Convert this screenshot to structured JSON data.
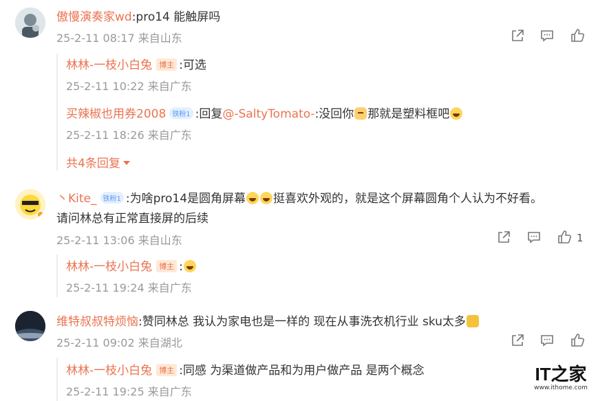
{
  "comments": [
    {
      "user": "傲慢演奏家wd",
      "text": ":pro14 能触屏吗",
      "time": "25-2-11 08:17 来自山东",
      "replies": [
        {
          "user": "林林-一枝小白兔",
          "badge": "博主",
          "text": ":可选",
          "time": "25-2-11 10:22 来自广东"
        },
        {
          "user": "买辣椒也用券2008",
          "badge": "铁粉1",
          "prefix": ":回复",
          "mention": "@-SaltyTomato-",
          "text_a": ":没回你",
          "text_b": "那就是塑料框吧",
          "time": "25-2-11 18:26 来自广东"
        }
      ],
      "more_label": "共4条回复"
    },
    {
      "user": "丶Kite_",
      "badge": "铁粉1",
      "text_a": ":为啥pro14是圆角屏幕",
      "text_b": "挺喜欢外观的，就是这个屏幕圆角个人认为不好看。",
      "text_c": "请问林总有正常直接屏的后续",
      "time": "25-2-11 13:06 来自山东",
      "like_count": "1",
      "replies": [
        {
          "user": "林林-一枝小白兔",
          "badge": "博主",
          "text": ":",
          "time": "25-2-11 19:24 来自广东"
        }
      ]
    },
    {
      "user": "维特叔叔特烦恼",
      "text": ":赞同林总 我认为家电也是一样的 现在从事洗衣机行业 sku太多",
      "time": "25-2-11 09:02 来自湖北",
      "replies": [
        {
          "user": "林林-一枝小白兔",
          "badge": "博主",
          "text": ":同感 为渠道做产品和为用户做产品 是两个概念",
          "time": "25-2-11 19:25 来自广东"
        }
      ]
    }
  ],
  "logo": {
    "text": "IT之家",
    "url": "www.ithome.com"
  }
}
